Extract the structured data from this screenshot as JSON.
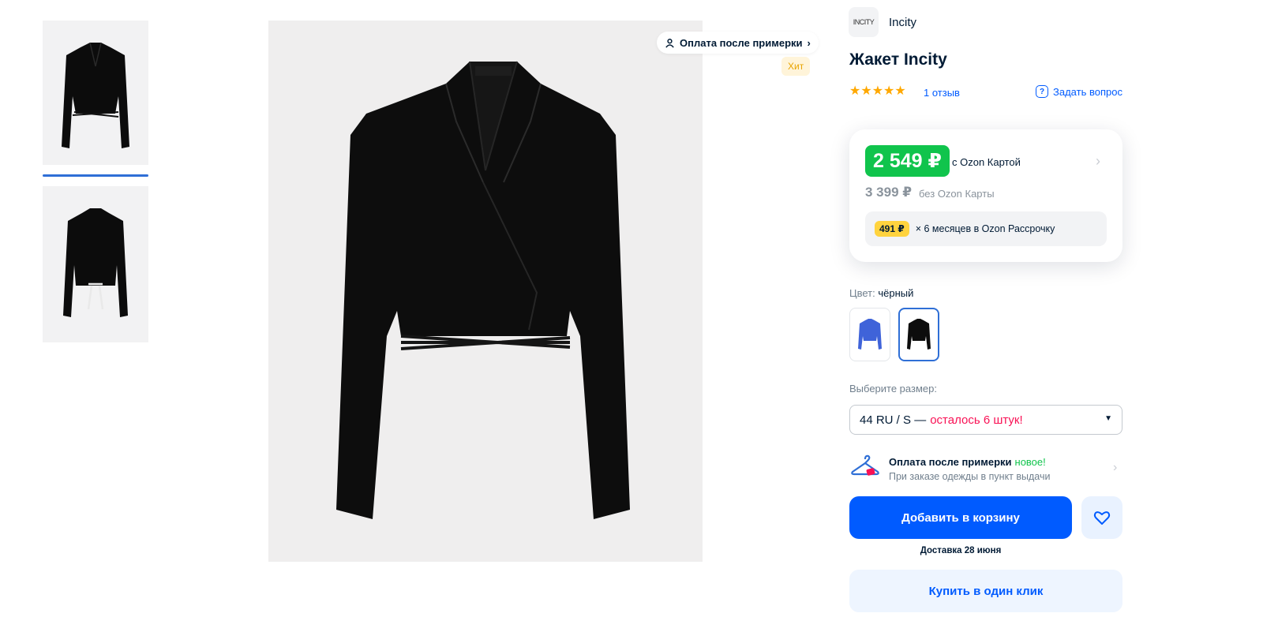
{
  "gallery": {
    "thumbnails": [
      {
        "view": "front",
        "selected": true
      },
      {
        "view": "back",
        "selected": false
      }
    ],
    "badges": {
      "try_on": "Оплата после примерки",
      "hit": "Хит"
    }
  },
  "product": {
    "brand_logo_text": "INCITY",
    "brand": "Incity",
    "title": "Жакет Incity",
    "rating": 5,
    "stars": "★★★★★",
    "reviews": "1 отзыв",
    "ask_question": "Задать вопрос"
  },
  "price": {
    "ozon_card_price": "2 549 ₽",
    "ozon_card_note": "с Ozon Картой",
    "regular_price": "3 399 ₽",
    "regular_note": "без Ozon Карты",
    "installment_amount": "491 ₽",
    "installment_note": "× 6 месяцев в Ozon Рассрочку"
  },
  "color": {
    "label": "Цвет:",
    "value": "чёрный",
    "options": [
      {
        "name": "blue",
        "hex": "#3f63d9",
        "selected": false
      },
      {
        "name": "black",
        "hex": "#0d0d0d",
        "selected": true
      }
    ]
  },
  "size": {
    "label": "Выберите размер:",
    "selected": "44 RU / S —",
    "stock_warning": "осталось 6 штук!"
  },
  "try_on": {
    "title": "Оплата после примерки",
    "new_tag": "новое!",
    "subtitle": "При заказе одежды в пункт выдачи"
  },
  "actions": {
    "add_to_cart": "Добавить в корзину",
    "delivery": "Доставка 28 июня",
    "buy_one_click": "Купить в один клик"
  },
  "colors": {
    "accent": "#005bff",
    "price_green": "#10c44c",
    "warning": "#f91155",
    "star": "#ffa800"
  }
}
